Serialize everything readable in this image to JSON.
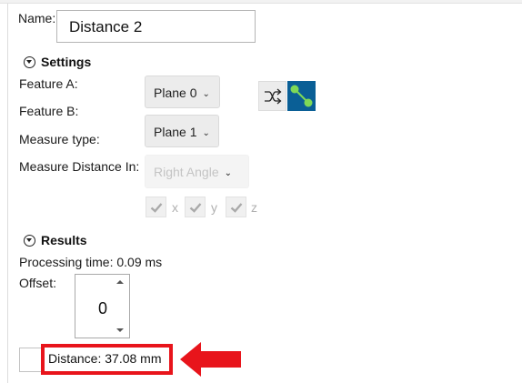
{
  "name": {
    "label": "Name:",
    "value": "Distance 2"
  },
  "settings": {
    "header": "Settings",
    "feature_a": {
      "label": "Feature A:",
      "value": "Plane 0"
    },
    "feature_b": {
      "label": "Feature B:",
      "value": "Plane 1"
    },
    "measure_type": {
      "label": "Measure type:"
    },
    "measure_distance_in": {
      "label": "Measure Distance In:",
      "value": "Right Angle"
    },
    "axes": [
      {
        "label": "x"
      },
      {
        "label": "y"
      },
      {
        "label": "z"
      }
    ]
  },
  "results": {
    "header": "Results",
    "processing_time": "Processing time: 0.09 ms",
    "offset": {
      "label": "Offset:",
      "value": "0"
    },
    "distance": "Distance: 37.08 mm"
  },
  "colors": {
    "accent_blue": "#0a5f96",
    "node_green": "#7ed957",
    "highlight_red": "#e8141b"
  },
  "icons": {
    "collapse": "collapse-circle-icon",
    "swap": "swap-arrows-icon",
    "connect": "connect-nodes-icon",
    "check": "checkmark-icon",
    "annotation": "arrow-left-icon"
  }
}
